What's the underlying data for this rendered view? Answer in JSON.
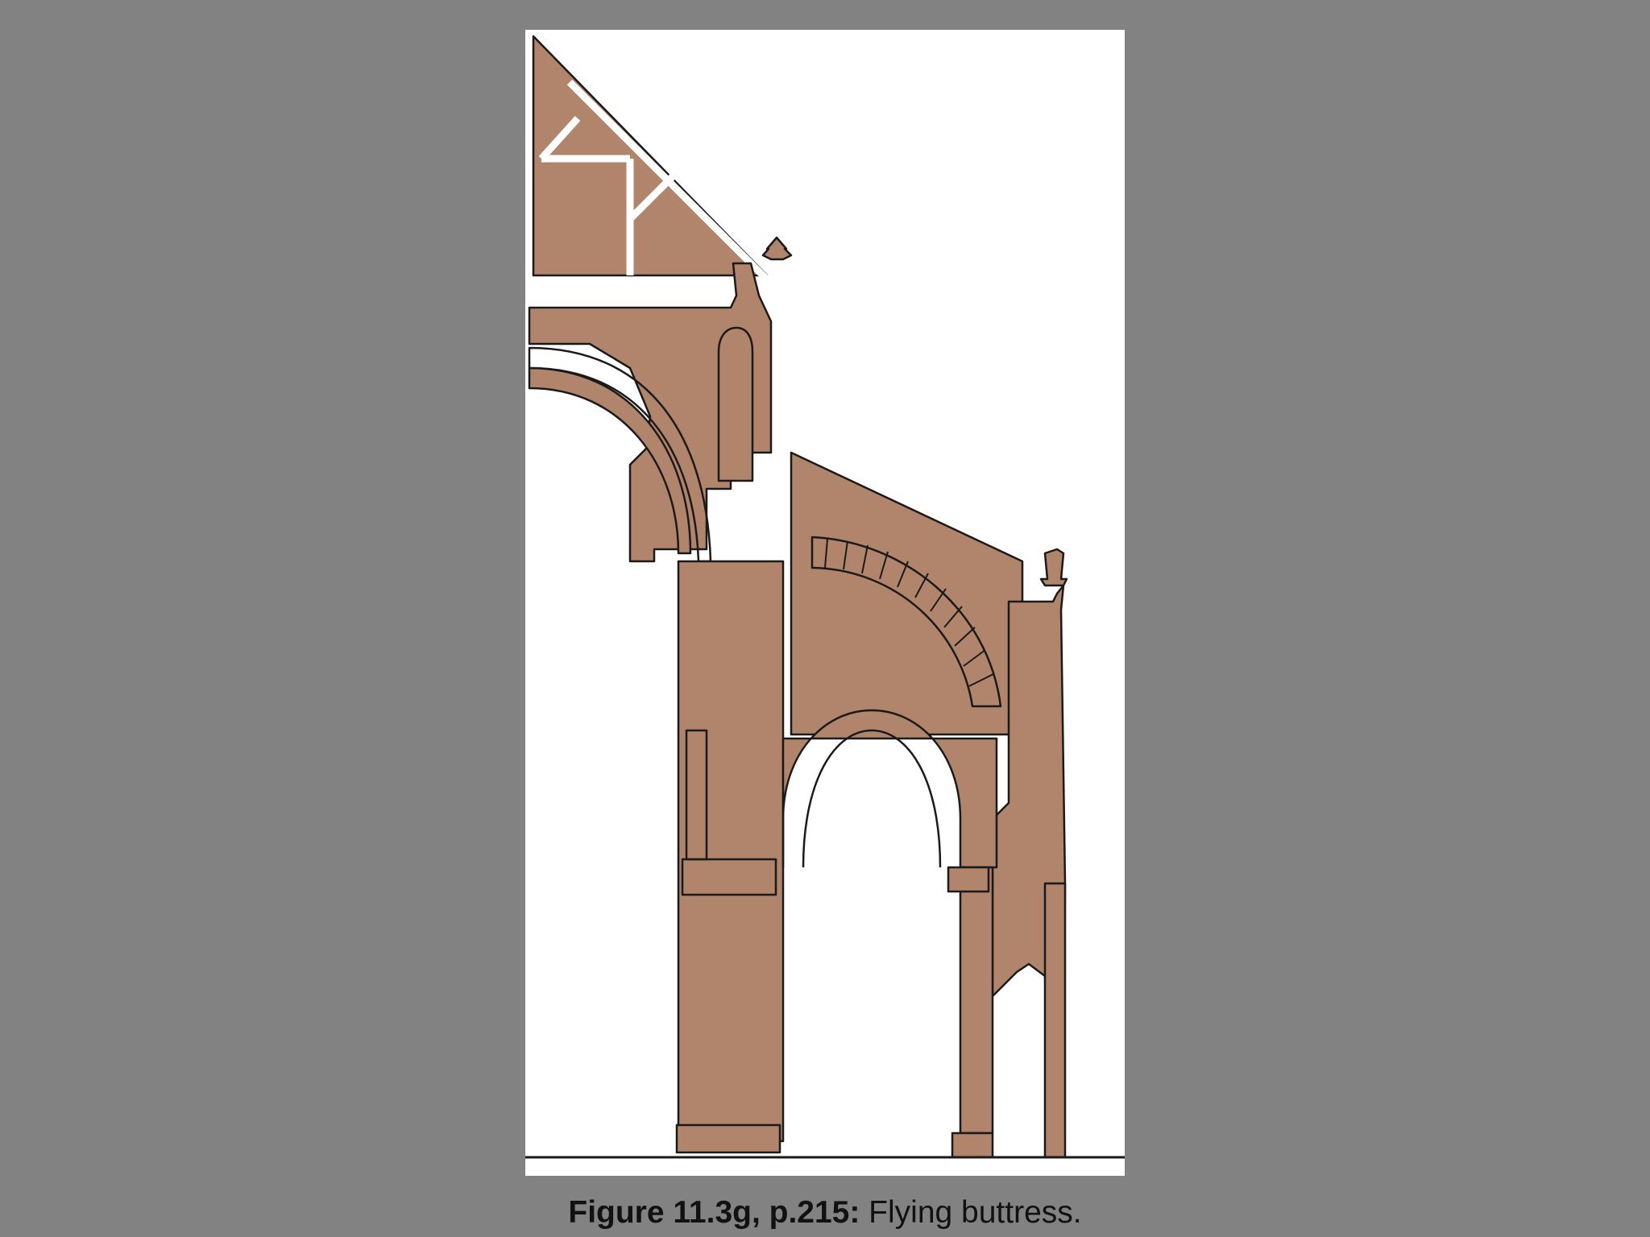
{
  "figure": {
    "caption_ref": "Figure 11.3g, p.215:",
    "caption_text": " Flying buttress.",
    "colors": {
      "background": "#828282",
      "panel": "#ffffff",
      "stone": "#b0856b",
      "outline": "#1a1a1a"
    }
  }
}
